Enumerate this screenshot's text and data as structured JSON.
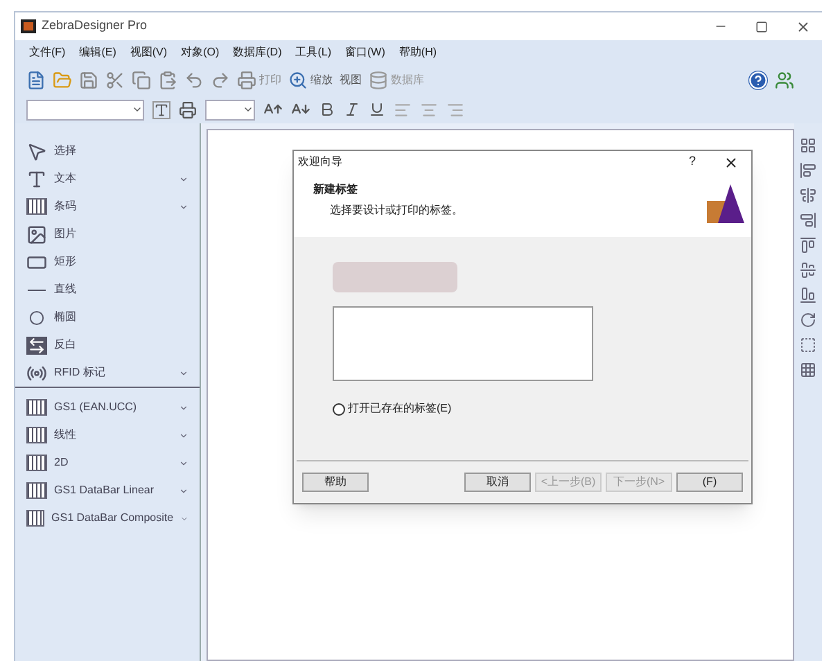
{
  "window": {
    "title": "ZebraDesigner Pro"
  },
  "menu": [
    "文件(F)",
    "编辑(E)",
    "视图(V)",
    "对象(O)",
    "数据库(D)",
    "工具(L)",
    "窗口(W)",
    "帮助(H)"
  ],
  "toolbar": {
    "print": "打印",
    "zoom": "缩放",
    "view": "视图",
    "database": "数据库"
  },
  "tools": [
    {
      "kind": "pointer",
      "label": "选择",
      "dropdown": false,
      "separator_before": false
    },
    {
      "kind": "text",
      "label": "文本",
      "dropdown": true,
      "separator_before": false
    },
    {
      "kind": "barcode",
      "label": "条码",
      "dropdown": true,
      "separator_before": false
    },
    {
      "kind": "picture",
      "label": "图片",
      "dropdown": false,
      "separator_before": false
    },
    {
      "kind": "rectangle",
      "label": "矩形",
      "dropdown": false,
      "separator_before": false
    },
    {
      "kind": "line",
      "label": "直线",
      "dropdown": false,
      "separator_before": false
    },
    {
      "kind": "ellipse",
      "label": "椭圆",
      "dropdown": false,
      "separator_before": false
    },
    {
      "kind": "inverse",
      "label": "反白",
      "dropdown": false,
      "separator_before": false
    },
    {
      "kind": "rfid",
      "label": "RFID 标记",
      "dropdown": true,
      "separator_before": false
    },
    {
      "kind": "barcode",
      "label": "GS1 (EAN.UCC)",
      "dropdown": true,
      "separator_before": true
    },
    {
      "kind": "barcode",
      "label": "线性",
      "dropdown": true,
      "separator_before": false
    },
    {
      "kind": "barcode",
      "label": "2D",
      "dropdown": true,
      "separator_before": false
    },
    {
      "kind": "barcode",
      "label": "GS1 DataBar Linear",
      "dropdown": true,
      "separator_before": false
    },
    {
      "kind": "barcode",
      "label": "GS1 DataBar Composite",
      "dropdown": true,
      "separator_before": false
    }
  ],
  "dialog": {
    "title": "欢迎向导",
    "help_mark": "?",
    "heading": "新建标签",
    "subheading": "选择要设计或打印的标签。",
    "option": {
      "label": "打开已存在的标签(E)",
      "selected": false
    },
    "buttons": [
      {
        "label": "帮助",
        "disabled": false
      },
      {
        "label": "取消",
        "disabled": false
      },
      {
        "label": "<上一步(B)",
        "disabled": true
      },
      {
        "label": "下一步(N>",
        "disabled": true
      },
      {
        "label": "(F)",
        "disabled": false
      }
    ]
  }
}
